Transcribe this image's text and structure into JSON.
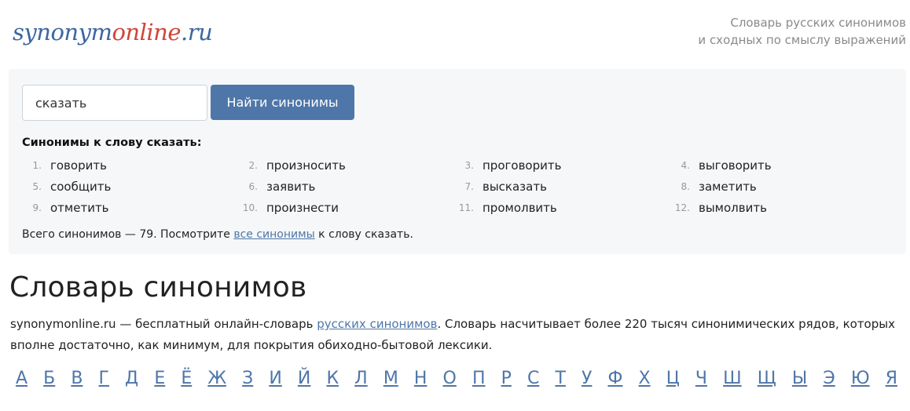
{
  "header": {
    "logo": {
      "part1": "synonym",
      "part2": "online",
      "part3": ".ru"
    },
    "tagline_line1": "Словарь русских синонимов",
    "tagline_line2": "и сходных по смыслу выражений"
  },
  "search": {
    "input_value": "сказать",
    "button_label": "Найти синонимы"
  },
  "synonyms": {
    "heading": "Синонимы к слову сказать:",
    "items": [
      {
        "n": "1.",
        "word": "говорить"
      },
      {
        "n": "2.",
        "word": "произносить"
      },
      {
        "n": "3.",
        "word": "проговорить"
      },
      {
        "n": "4.",
        "word": "выговорить"
      },
      {
        "n": "5.",
        "word": "сообщить"
      },
      {
        "n": "6.",
        "word": "заявить"
      },
      {
        "n": "7.",
        "word": "высказать"
      },
      {
        "n": "8.",
        "word": "заметить"
      },
      {
        "n": "9.",
        "word": "отметить"
      },
      {
        "n": "10.",
        "word": "произнести"
      },
      {
        "n": "11.",
        "word": "промолвить"
      },
      {
        "n": "12.",
        "word": "вымолвить"
      }
    ],
    "total_prefix": "Всего синонимов — 79. Посмотрите ",
    "total_link": "все синонимы",
    "total_suffix": " к слову сказать."
  },
  "dictionary": {
    "title": "Словарь синонимов",
    "intro_prefix": "synonymonline.ru — бесплатный онлайн-словарь ",
    "intro_link": "русских синонимов",
    "intro_suffix": ". Словарь насчитывает более 220 тысяч синонимических рядов, которых вполне достаточно, как минимум, для покрытия обиходно-бытовой лексики."
  },
  "alphabet": [
    "А",
    "Б",
    "В",
    "Г",
    "Д",
    "Е",
    "Ё",
    "Ж",
    "З",
    "И",
    "Й",
    "К",
    "Л",
    "М",
    "Н",
    "О",
    "П",
    "Р",
    "С",
    "Т",
    "У",
    "Ф",
    "Х",
    "Ц",
    "Ч",
    "Ш",
    "Щ",
    "Ы",
    "Э",
    "Ю",
    "Я"
  ],
  "colors": {
    "accent": "#4f76a8",
    "logo_red": "#d0453a",
    "panel_bg": "#f5f7f9"
  }
}
